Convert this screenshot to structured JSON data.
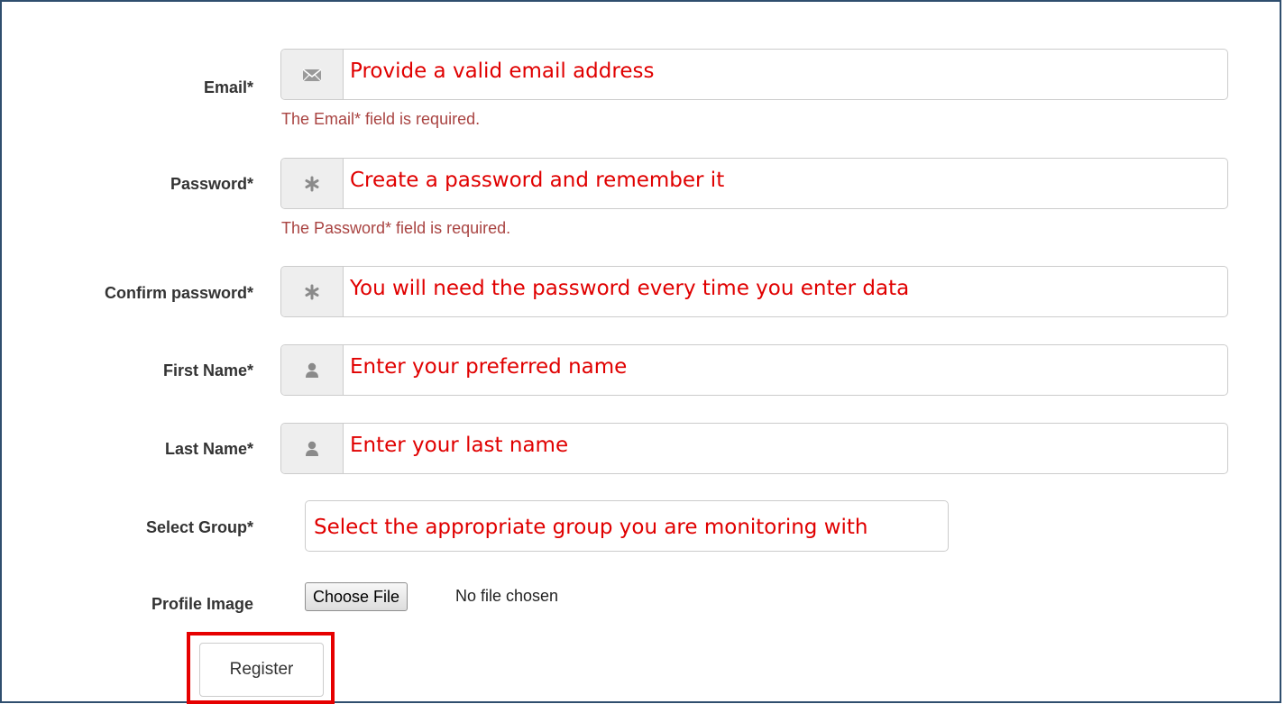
{
  "form": {
    "email": {
      "label": "Email*",
      "icon": "envelope-icon",
      "value": "Provide a valid email address",
      "error": "The Email* field is required."
    },
    "password": {
      "label": "Password*",
      "icon": "asterisk-icon",
      "value": "Create a password and remember it",
      "error": "The Password* field is required."
    },
    "confirm_password": {
      "label": "Confirm password*",
      "icon": "asterisk-icon",
      "value": "You will need the password every time you enter data"
    },
    "first_name": {
      "label": "First Name*",
      "icon": "user-icon",
      "value": "Enter your preferred name"
    },
    "last_name": {
      "label": "Last Name*",
      "icon": "user-icon",
      "value": "Enter your last name"
    },
    "group": {
      "label": "Select Group*",
      "value": "Select the appropriate group you are monitoring with"
    },
    "profile_image": {
      "label": "Profile Image",
      "button": "Choose File",
      "status": "No file chosen"
    },
    "register_label": "Register"
  },
  "colors": {
    "annotation_text": "#e00000",
    "error_text": "#a94442",
    "highlight_border": "#e60000",
    "frame_border": "#2f4e6e"
  }
}
